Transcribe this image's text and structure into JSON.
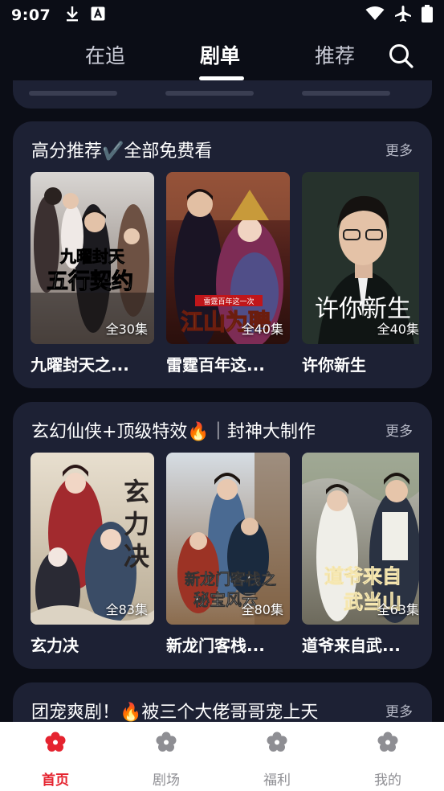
{
  "status_bar": {
    "time": "9:07",
    "left_icons": [
      "download-icon",
      "a-notification-icon"
    ],
    "right_icons": [
      "wifi-icon",
      "airplane-icon",
      "battery-icon"
    ]
  },
  "top_tabs": {
    "items": [
      {
        "label": "在追",
        "active": false
      },
      {
        "label": "剧单",
        "active": true
      },
      {
        "label": "推荐",
        "active": false
      }
    ],
    "search_icon": "search-icon"
  },
  "sections": [
    {
      "title": "高分推荐✔️全部免费看",
      "more": "更多",
      "items": [
        {
          "title": "九曜封天之...",
          "episodes": "全30集",
          "poster_text": "九曜封天之 五行契约"
        },
        {
          "title": "雷霆百年这...",
          "episodes": "全40集",
          "poster_text": "江山为聘"
        },
        {
          "title": "许你新生",
          "episodes": "全40集",
          "poster_text": "许你新生"
        }
      ]
    },
    {
      "title": "玄幻仙侠+顶级特效🔥｜封神大制作",
      "more": "更多",
      "items": [
        {
          "title": "玄力决",
          "episodes": "全83集",
          "poster_text": "玄力决"
        },
        {
          "title": "新龙门客栈...",
          "episodes": "全80集",
          "poster_text": "新龙门客栈之 秘宝风云"
        },
        {
          "title": "道爷来自武...",
          "episodes": "全63集",
          "poster_text": "道爷来自 武当山"
        }
      ]
    },
    {
      "title": "团宠爽剧！🔥被三个大佬哥哥宠上天",
      "more": "更多",
      "items": []
    }
  ],
  "bottom_nav": {
    "items": [
      {
        "label": "首页",
        "icon": "flower-icon",
        "active": true
      },
      {
        "label": "剧场",
        "icon": "flower-icon",
        "active": false
      },
      {
        "label": "福利",
        "icon": "flower-icon",
        "active": false
      },
      {
        "label": "我的",
        "icon": "flower-icon",
        "active": false
      }
    ]
  },
  "colors": {
    "background": "#0b0d16",
    "card": "#1d2134",
    "accent": "#e5232f",
    "nav_inactive": "#8e8e93"
  }
}
